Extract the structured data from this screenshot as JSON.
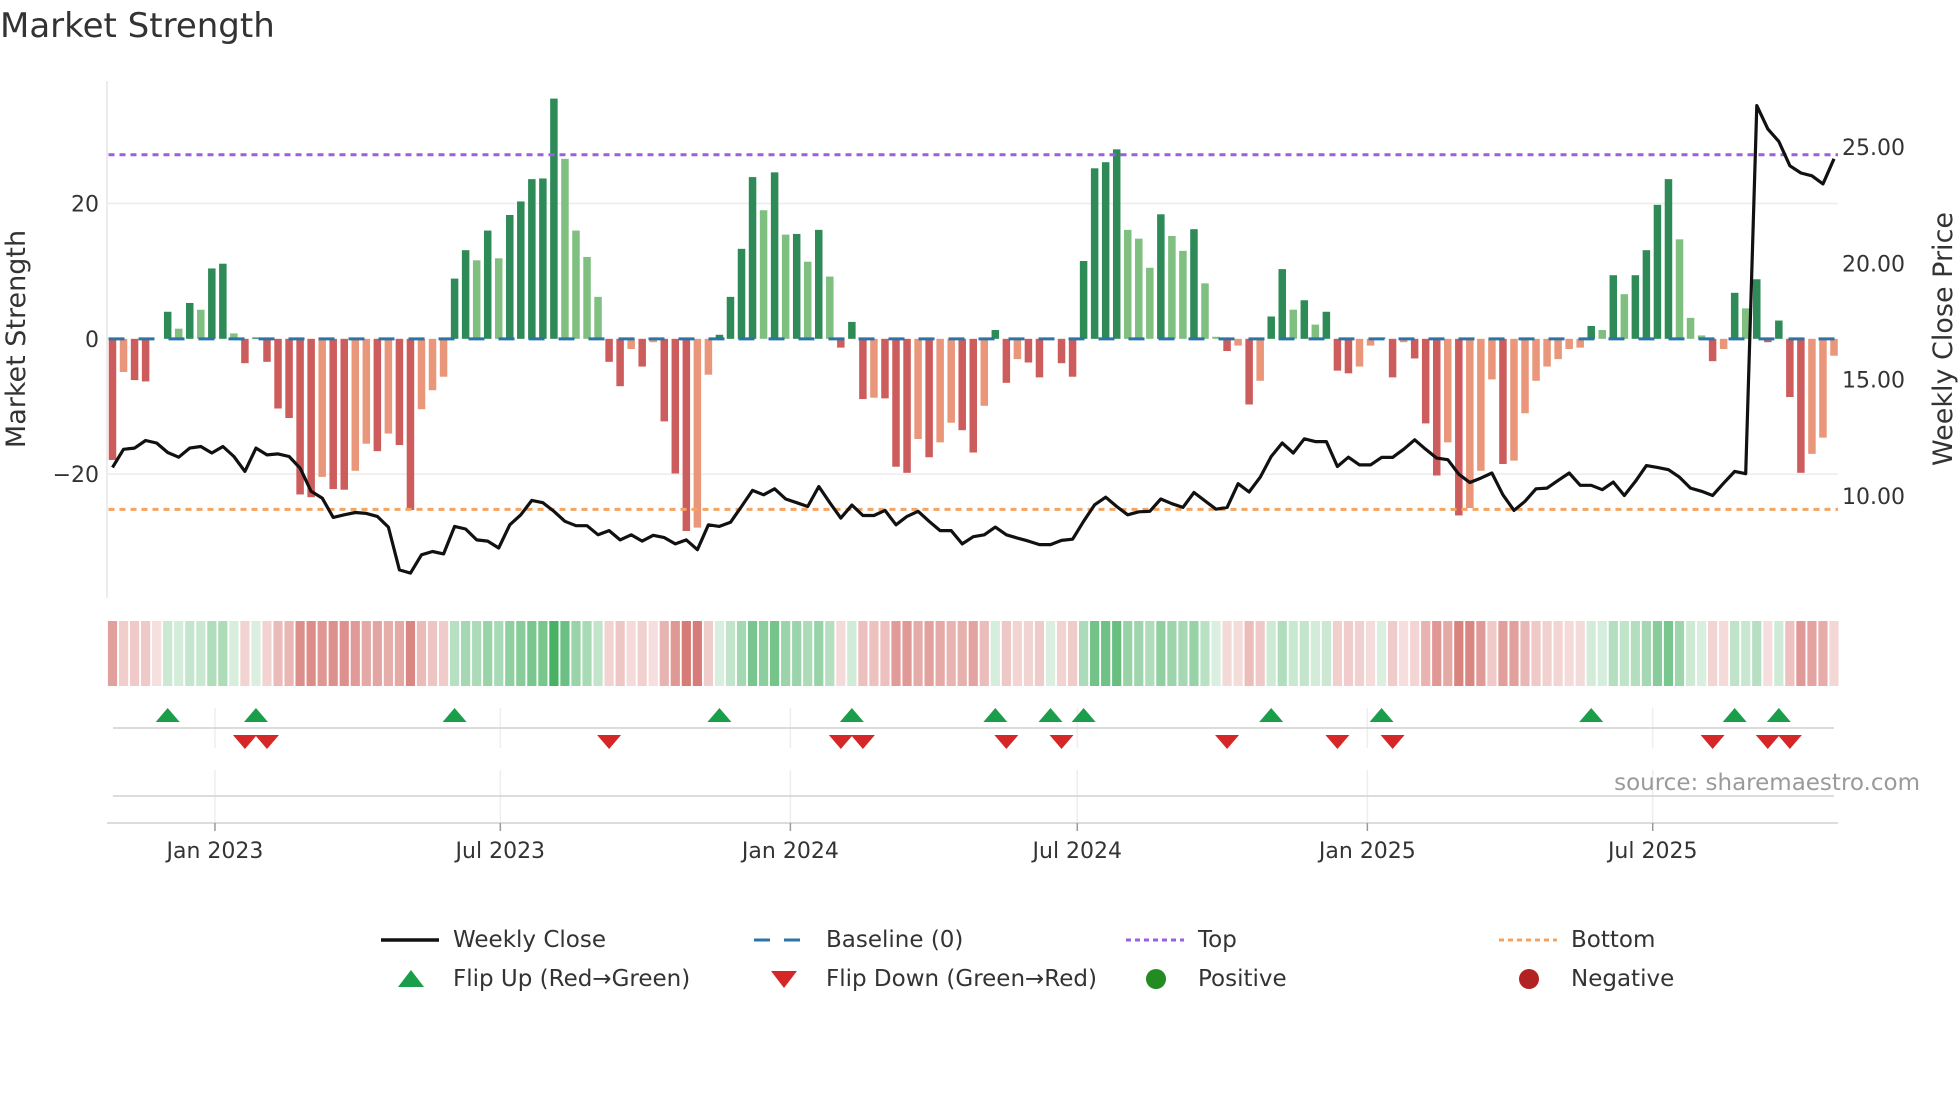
{
  "title": "Market Strength",
  "source": "source: sharemaestro.com",
  "colors": {
    "green_dark": "#2e8b57",
    "green_light": "#7fbf7f",
    "red_dark": "#cd5c5c",
    "red_light": "#e9967a",
    "baseline": "#2a74a8",
    "top": "#9b5fe0",
    "bottom": "#f4a460",
    "price": "#111111",
    "heat_green": "#34a853",
    "heat_red": "#c9504a",
    "flip_up": "#1a9e4a",
    "flip_down": "#d62728",
    "positive": "#228b22",
    "negative": "#b22222"
  },
  "chart_data": {
    "type": "bar",
    "title": "Market Strength",
    "ylabel": "Market Strength",
    "y2label": "Weekly Close Price",
    "ylim": [
      -38.3,
      38.1
    ],
    "y2lim": [
      5.6,
      27.85
    ],
    "yticks": [
      {
        "value": 20,
        "label": "20"
      },
      {
        "value": 0,
        "label": "0"
      },
      {
        "value": -20,
        "label": "−20"
      }
    ],
    "y2ticks": [
      {
        "value": 25,
        "label": "25.00"
      },
      {
        "value": 20,
        "label": "20.00"
      },
      {
        "value": 15,
        "label": "15.00"
      },
      {
        "value": 10,
        "label": "10.00"
      }
    ],
    "start_week": "2022-10-28",
    "xticks": [
      {
        "date": "2023-01-01",
        "label": "Jan 2023"
      },
      {
        "date": "2023-07-01",
        "label": "Jul 2023"
      },
      {
        "date": "2024-01-01",
        "label": "Jan 2024"
      },
      {
        "date": "2024-07-01",
        "label": "Jul 2024"
      },
      {
        "date": "2025-01-01",
        "label": "Jan 2025"
      },
      {
        "date": "2025-07-01",
        "label": "Jul 2025"
      }
    ],
    "top_level": 27.2,
    "bottom_level": -25.2,
    "grid": true,
    "strength": [
      -17.9,
      -4.9,
      -6.1,
      -6.3,
      0,
      4.0,
      1.5,
      5.3,
      4.3,
      10.4,
      11.1,
      0.8,
      -3.6,
      0.2,
      -3.4,
      -10.3,
      -11.7,
      -23.0,
      -23.4,
      -20.4,
      -22.2,
      -22.3,
      -19.5,
      -15.5,
      -16.6,
      -14.0,
      -15.7,
      -25.3,
      -10.4,
      -7.6,
      -5.6,
      8.9,
      13.1,
      11.6,
      16.0,
      11.9,
      18.3,
      20.3,
      23.6,
      23.7,
      35.5,
      26.6,
      16.0,
      12.1,
      6.2,
      -3.4,
      -7.0,
      -1.5,
      -4.1,
      -0.5,
      -12.2,
      -19.9,
      -28.4,
      -27.9,
      -5.3,
      0.6,
      6.2,
      13.3,
      23.9,
      19.0,
      24.6,
      15.4,
      15.5,
      11.4,
      16.1,
      9.2,
      -1.3,
      2.5,
      -8.9,
      -8.7,
      -8.8,
      -18.9,
      -19.8,
      -14.8,
      -17.5,
      -15.3,
      -12.4,
      -13.5,
      -16.8,
      -9.9,
      1.3,
      -6.5,
      -3.0,
      -3.5,
      -5.7,
      0.2,
      -3.6,
      -5.6,
      11.5,
      25.2,
      26.1,
      28.0,
      16.1,
      14.8,
      10.5,
      18.4,
      15.2,
      13.0,
      16.2,
      8.2,
      0.3,
      -1.8,
      -1.0,
      -9.7,
      -6.2,
      3.3,
      10.3,
      4.3,
      5.7,
      2.1,
      4.0,
      -4.7,
      -5.1,
      -4.1,
      -1.0,
      0.2,
      -5.7,
      -0.5,
      -2.9,
      -12.5,
      -20.2,
      -15.3,
      -26.1,
      -25.0,
      -19.5,
      -6.0,
      -18.5,
      -18.0,
      -11.0,
      -6.2,
      -4.1,
      -3.0,
      -1.5,
      -1.3,
      1.9,
      1.3,
      9.4,
      6.6,
      9.4,
      13.1,
      19.8,
      23.6,
      14.7,
      3.1,
      0.5,
      -3.3,
      -1.5,
      6.8,
      4.5,
      8.8,
      -0.5,
      2.7,
      -8.6,
      -19.8,
      -17.0,
      -14.6,
      -2.5
    ],
    "weekly_close": [
      11.22,
      12.0,
      12.05,
      12.38,
      12.27,
      11.86,
      11.66,
      12.05,
      12.12,
      11.84,
      12.12,
      11.69,
      11.05,
      12.05,
      11.76,
      11.8,
      11.69,
      11.19,
      10.19,
      9.9,
      9.07,
      9.18,
      9.28,
      9.24,
      9.11,
      8.65,
      6.81,
      6.67,
      7.46,
      7.6,
      7.5,
      8.68,
      8.57,
      8.1,
      8.05,
      7.75,
      8.75,
      9.18,
      9.8,
      9.7,
      9.33,
      8.9,
      8.71,
      8.71,
      8.32,
      8.5,
      8.1,
      8.32,
      8.05,
      8.3,
      8.2,
      7.93,
      8.1,
      7.68,
      8.75,
      8.68,
      8.86,
      9.54,
      10.23,
      10.04,
      10.3,
      9.86,
      9.7,
      9.54,
      10.4,
      9.7,
      9.04,
      9.6,
      9.15,
      9.15,
      9.37,
      8.75,
      9.11,
      9.33,
      8.9,
      8.5,
      8.5,
      7.93,
      8.24,
      8.32,
      8.65,
      8.32,
      8.18,
      8.05,
      7.9,
      7.9,
      8.08,
      8.13,
      8.9,
      9.61,
      9.94,
      9.54,
      9.18,
      9.31,
      9.33,
      9.86,
      9.66,
      9.5,
      10.14,
      9.78,
      9.42,
      9.5,
      10.52,
      10.16,
      10.8,
      11.69,
      12.27,
      11.84,
      12.45,
      12.33,
      12.33,
      11.26,
      11.66,
      11.33,
      11.33,
      11.65,
      11.65,
      12.0,
      12.41,
      12.0,
      11.62,
      11.55,
      10.93,
      10.57,
      10.76,
      10.98,
      10.04,
      9.37,
      9.76,
      10.3,
      10.33,
      10.66,
      10.98,
      10.45,
      10.45,
      10.26,
      10.59,
      10.01,
      10.62,
      11.3,
      11.22,
      11.12,
      10.8,
      10.33,
      10.19,
      10.01,
      10.54,
      11.05,
      10.95,
      26.79,
      25.79,
      25.25,
      24.2,
      23.89,
      23.77,
      23.42,
      24.5
    ],
    "flip_up_weeks": [
      6,
      14,
      32,
      56,
      68,
      81,
      86,
      89,
      106,
      116,
      135,
      148,
      152
    ],
    "flip_down_weeks": [
      13,
      15,
      46,
      67,
      69,
      82,
      87,
      102,
      112,
      117,
      146,
      151,
      153
    ],
    "legend": [
      {
        "label": "Weekly Close",
        "symbol": "line"
      },
      {
        "label": "Baseline (0)",
        "symbol": "dash"
      },
      {
        "label": "Top",
        "symbol": "dot-top"
      },
      {
        "label": "Bottom",
        "symbol": "dot-bottom"
      },
      {
        "label": "Flip Up (Red→Green)",
        "symbol": "tri-up"
      },
      {
        "label": "Flip Down (Green→Red)",
        "symbol": "tri-down"
      },
      {
        "label": "Positive",
        "symbol": "circle-pos"
      },
      {
        "label": "Negative",
        "symbol": "circle-neg"
      }
    ],
    "legend_position": "bottom"
  }
}
